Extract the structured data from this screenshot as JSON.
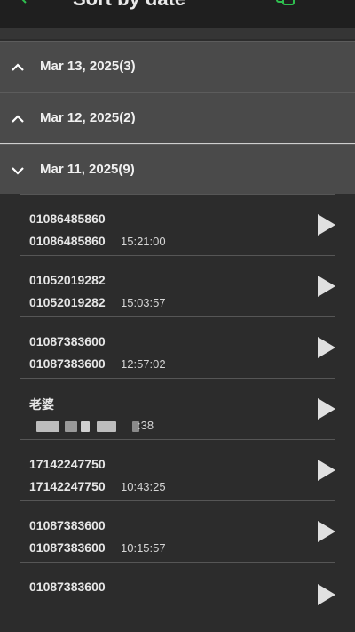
{
  "topbar": {
    "title": "Sort by date",
    "back_icon": "arrow-back-icon",
    "action_icon": "sort-icon",
    "accent_color": "#2fbf4f"
  },
  "groups": [
    {
      "label": "Mar 13, 2025(3)",
      "expanded": false
    },
    {
      "label": "Mar 12, 2025(2)",
      "expanded": false
    },
    {
      "label": "Mar 11, 2025(9)",
      "expanded": true
    }
  ],
  "records": [
    {
      "name": "01086485860",
      "number": "01086485860",
      "time": "15:21:00"
    },
    {
      "name": "01052019282",
      "number": "01052019282",
      "time": "15:03:57"
    },
    {
      "name": "01087383600",
      "number": "01087383600",
      "time": "12:57:02"
    },
    {
      "name": "老婆",
      "number": "",
      "time": ":38"
    },
    {
      "name": "17142247750",
      "number": "17142247750",
      "time": "10:43:25"
    },
    {
      "name": "01087383600",
      "number": "01087383600",
      "time": "10:15:57"
    },
    {
      "name": "01087383600",
      "number": "",
      "time": ""
    }
  ]
}
